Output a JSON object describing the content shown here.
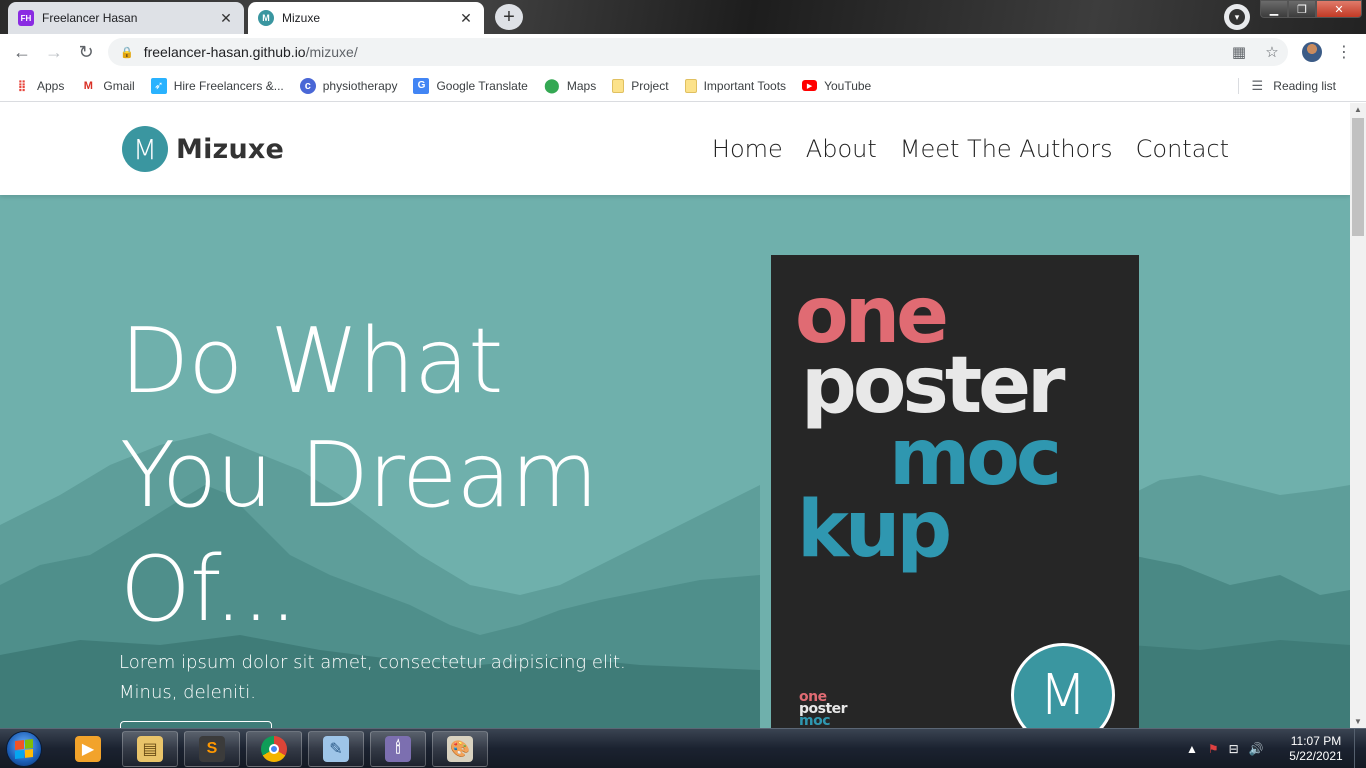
{
  "browser": {
    "tabs": [
      {
        "label": "Freelancer Hasan",
        "favicon": "FH",
        "favicon_color": "#8a2be2",
        "active": false
      },
      {
        "label": "Mizuxe",
        "favicon": "M",
        "favicon_color": "#3a96a0",
        "active": true
      }
    ],
    "url_host": "freelancer-hasan.github.io",
    "url_path": "/mizuxe/",
    "bookmarks": [
      {
        "label": "Apps",
        "icon": "apps-grid-icon"
      },
      {
        "label": "Gmail",
        "icon": "gmail-icon"
      },
      {
        "label": "Hire Freelancers &...",
        "icon": "freelancer-icon"
      },
      {
        "label": "physiotherapy",
        "icon": "physiotherapy-icon"
      },
      {
        "label": "Google Translate",
        "icon": "translate-icon"
      },
      {
        "label": "Maps",
        "icon": "maps-icon"
      },
      {
        "label": "Project",
        "icon": "folder-icon"
      },
      {
        "label": "Important Toots",
        "icon": "folder-icon"
      },
      {
        "label": "YouTube",
        "icon": "youtube-icon"
      }
    ],
    "reading_list": "Reading list"
  },
  "site": {
    "logo_letter": "M",
    "brand": "Mizuxe",
    "nav": [
      "Home",
      "About",
      "Meet The Authors",
      "Contact"
    ],
    "hero": {
      "title_lines": [
        "Do What",
        "You Dream",
        "Of..."
      ],
      "text": "Lorem ipsum dolor sit amet, consectetur adipisicing elit. Minus, deleniti."
    },
    "poster": {
      "word1": "one",
      "word2": "poster",
      "word3": "moc",
      "word4": "kup",
      "mini1": "one",
      "mini2": "poster",
      "mini3": "moc",
      "badge": "M"
    },
    "colors": {
      "accent": "#3a96a0",
      "hero_bg": "#6fb0ac",
      "poster_red": "#e06b73",
      "poster_white": "#e8e8e8",
      "poster_teal": "#2f97b0"
    }
  },
  "taskbar": {
    "time": "11:07 PM",
    "date": "5/22/2021"
  }
}
